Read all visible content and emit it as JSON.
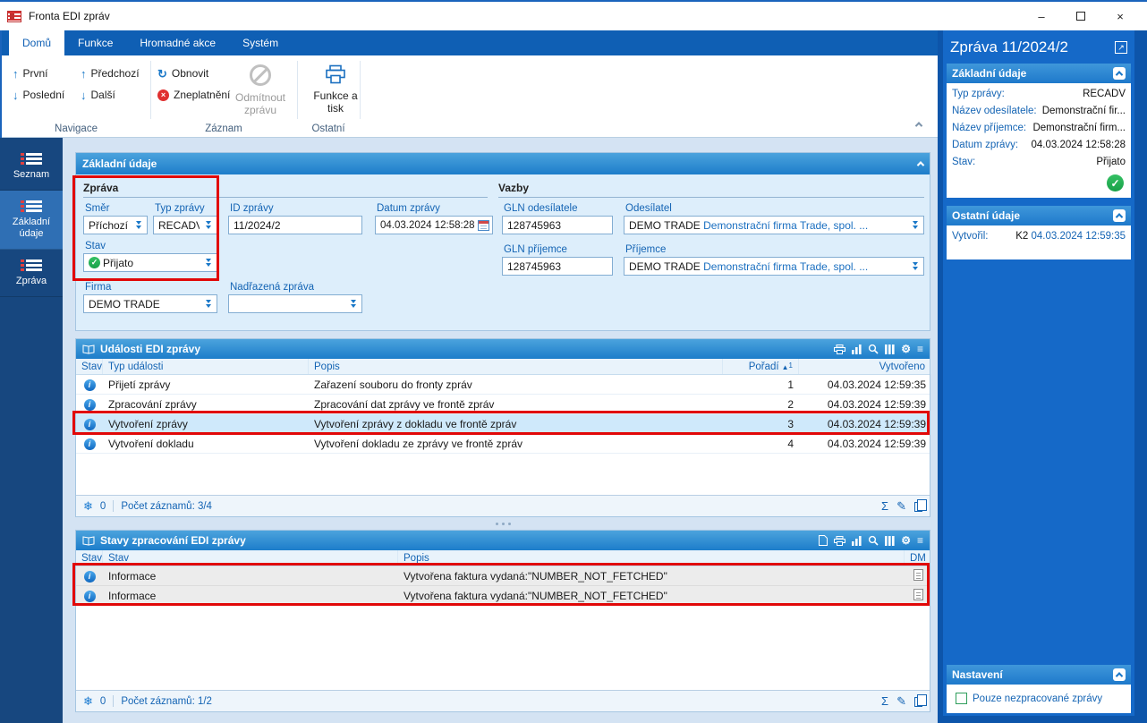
{
  "colors": {
    "accent": "#0f5fb4",
    "panel_header": "#1d7dca",
    "right_panel": "#1569c8",
    "sidebar": "#17477f",
    "label_blue": "#1464b4",
    "annotation_red": "#e10808",
    "status_green": "#18a048"
  },
  "window": {
    "title": "Fronta EDI zpráv"
  },
  "ribbon": {
    "tabs": [
      {
        "label": "Domů"
      },
      {
        "label": "Funkce"
      },
      {
        "label": "Hromadné akce"
      },
      {
        "label": "Systém"
      }
    ],
    "nav": {
      "first": "První",
      "last": "Poslední",
      "prev": "Předchozí",
      "next": "Další",
      "group": "Navigace"
    },
    "record": {
      "refresh": "Obnovit",
      "invalidate": "Zneplatnění",
      "reject": "Odmítnout zprávu",
      "group": "Záznam"
    },
    "other": {
      "functions": "Funkce a tisk",
      "group": "Ostatní"
    }
  },
  "sidebar": {
    "items": [
      {
        "label": "Seznam"
      },
      {
        "label": "Základní údaje"
      },
      {
        "label": "Zpráva"
      }
    ]
  },
  "basic": {
    "header": "Základní údaje",
    "zprava": {
      "title": "Zpráva",
      "smer_label": "Směr",
      "smer_value": "Příchozí",
      "typ_label": "Typ zprávy",
      "typ_value": "RECADV",
      "id_label": "ID zprávy",
      "id_value": "11/2024/2",
      "datum_label": "Datum zprávy",
      "datum_value": "04.03.2024 12:58:28",
      "stav_label": "Stav",
      "stav_value": "Přijato",
      "firma_label": "Firma",
      "firma_value": "DEMO TRADE",
      "nadrazena_label": "Nadřazená zpráva",
      "nadrazena_value": ""
    },
    "vazby": {
      "title": "Vazby",
      "gln_odesilatele_label": "GLN odesílatele",
      "gln_odesilatele_value": "128745963",
      "odesilatel_label": "Odesílatel",
      "odesilatel_code": "DEMO TRADE",
      "odesilatel_name": "Demonstrační firma Trade, spol. ...",
      "gln_prijemce_label": "GLN příjemce",
      "gln_prijemce_value": "128745963",
      "prijemce_label": "Příjemce",
      "prijemce_code": "DEMO TRADE",
      "prijemce_name": "Demonstrační firma Trade, spol. ..."
    }
  },
  "events": {
    "header": "Události EDI zprávy",
    "columns": {
      "stav": "Stav",
      "typ": "Typ události",
      "popis": "Popis",
      "poradi": "Pořadí",
      "vytvoreno": "Vytvořeno"
    },
    "sort_marker": "1",
    "rows": [
      {
        "typ": "Přijetí zprávy",
        "popis": "Zařazení souboru do fronty zpráv",
        "poradi": "1",
        "vytvoreno": "04.03.2024 12:59:35"
      },
      {
        "typ": "Zpracování zprávy",
        "popis": "Zpracování dat zprávy ve frontě zpráv",
        "poradi": "2",
        "vytvoreno": "04.03.2024 12:59:39"
      },
      {
        "typ": "Vytvoření zprávy",
        "popis": "Vytvoření zprávy z dokladu ve frontě zpráv",
        "poradi": "3",
        "vytvoreno": "04.03.2024 12:59:39"
      },
      {
        "typ": "Vytvoření dokladu",
        "popis": "Vytvoření dokladu ze zprávy ve frontě zpráv",
        "poradi": "4",
        "vytvoreno": "04.03.2024 12:59:39"
      }
    ],
    "footer": {
      "frozen": "0",
      "count": "Počet záznamů: 3/4"
    }
  },
  "statuses": {
    "header": "Stavy zpracování EDI zprávy",
    "columns": {
      "stav": "Stav",
      "stav2": "Stav",
      "popis": "Popis",
      "dm": "DM"
    },
    "rows": [
      {
        "stav": "Informace",
        "popis": "Vytvořena faktura vydaná:\"NUMBER_NOT_FETCHED\""
      },
      {
        "stav": "Informace",
        "popis": "Vytvořena faktura vydaná:\"NUMBER_NOT_FETCHED\""
      }
    ],
    "footer": {
      "frozen": "0",
      "count": "Počet záznamů: 1/2"
    }
  },
  "right": {
    "title": "Zpráva 11/2024/2",
    "basic": {
      "header": "Základní údaje",
      "rows": [
        {
          "label": "Typ zprávy:",
          "value": "RECADV"
        },
        {
          "label": "Název odesílatele:",
          "value": "Demonstrační fir..."
        },
        {
          "label": "Název příjemce:",
          "value": "Demonstrační firm..."
        },
        {
          "label": "Datum zprávy:",
          "value": "04.03.2024 12:58:28"
        },
        {
          "label": "Stav:",
          "value": "Přijato"
        }
      ]
    },
    "other": {
      "header": "Ostatní údaje",
      "created_label": "Vytvořil:",
      "created_user": "K2",
      "created_date": "04.03.2024 12:59:35"
    },
    "settings": {
      "header": "Nastavení",
      "checkbox_label": "Pouze nezpracované zprávy"
    }
  },
  "icons": {
    "info": "i",
    "check": "✓",
    "up": "↑",
    "down": "↓",
    "refresh": "↻",
    "x": "×",
    "sum": "Σ",
    "pencil": "✎",
    "freeze": "❄",
    "gear": "⚙",
    "menu": "≡",
    "sort": "▲",
    "expand": "↗",
    "min": "–",
    "close": "×"
  }
}
